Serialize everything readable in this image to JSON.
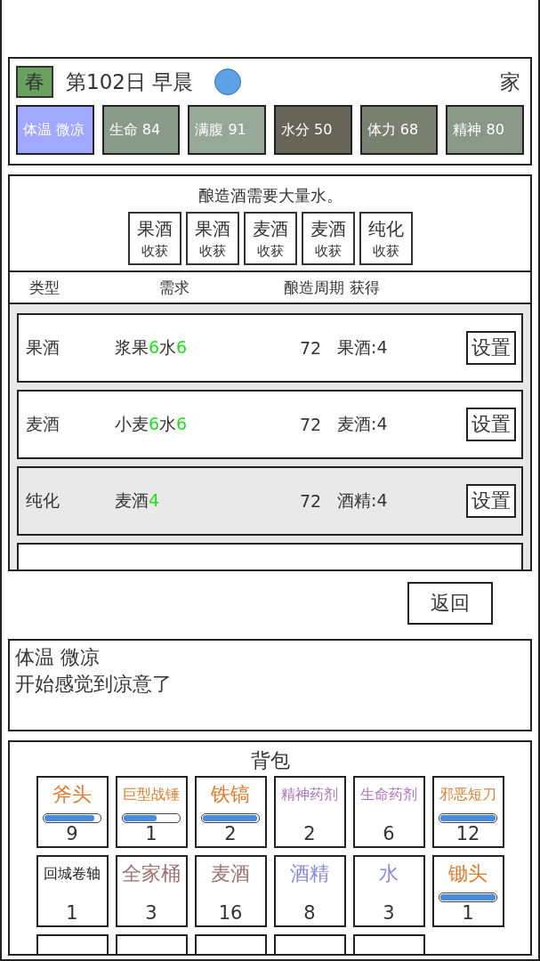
{
  "header": {
    "season": "春",
    "date": "第102日 早晨",
    "location": "家",
    "stats": [
      {
        "label": "体温 微凉",
        "color": "#a0a8ff"
      },
      {
        "label": "生命 84",
        "color": "#8a9a88"
      },
      {
        "label": "满腹 91",
        "color": "#98a898"
      },
      {
        "label": "水分 50",
        "color": "#666658"
      },
      {
        "label": "体力 68",
        "color": "#7a8070"
      },
      {
        "label": "精神 80",
        "color": "#8a9888"
      }
    ]
  },
  "brewing": {
    "notice": "酿造酒需要大量水。",
    "harvest_buttons": [
      {
        "name": "果酒",
        "action": "收获"
      },
      {
        "name": "果酒",
        "action": "收获"
      },
      {
        "name": "麦酒",
        "action": "收获"
      },
      {
        "name": "麦酒",
        "action": "收获"
      },
      {
        "name": "纯化",
        "action": "收获"
      }
    ],
    "columns": [
      "类型",
      "需求",
      "酿造周期",
      "获得"
    ],
    "recipes": [
      {
        "type": "果酒",
        "needs": [
          {
            "kind": "name",
            "text": "浆果"
          },
          {
            "kind": "amount",
            "text": "6"
          },
          {
            "kind": "name",
            "text": "水"
          },
          {
            "kind": "amount",
            "text": "6"
          }
        ],
        "cycle": "72",
        "yield": "果酒:4",
        "button": "设置",
        "selected": false
      },
      {
        "type": "麦酒",
        "needs": [
          {
            "kind": "name",
            "text": "小麦"
          },
          {
            "kind": "amount",
            "text": "6"
          },
          {
            "kind": "name",
            "text": "水"
          },
          {
            "kind": "amount",
            "text": "6"
          }
        ],
        "cycle": "72",
        "yield": "麦酒:4",
        "button": "设置",
        "selected": false
      },
      {
        "type": "纯化",
        "needs": [
          {
            "kind": "name",
            "text": "麦酒"
          },
          {
            "kind": "amount",
            "text": "4"
          }
        ],
        "cycle": "72",
        "yield": "酒精:4",
        "button": "设置",
        "selected": true
      }
    ]
  },
  "back_button": "返回",
  "message": {
    "title": "体温 微凉",
    "text": "开始感觉到凉意了"
  },
  "backpack": {
    "title": "背包",
    "items": [
      {
        "kind": "tool",
        "name": "斧头",
        "color": "#e07a2c",
        "level": 0.9,
        "count": "9"
      },
      {
        "kind": "tool",
        "name": "巨型战锤",
        "color": "#e07a2c",
        "level": 0.6,
        "count": "1"
      },
      {
        "kind": "tool",
        "name": "铁镐",
        "color": "#e07a2c",
        "level": 0.98,
        "count": "2"
      },
      {
        "kind": "plain",
        "name": "精神药剂",
        "color": "#b070c0",
        "count": "2"
      },
      {
        "kind": "plain",
        "name": "生命药剂",
        "color": "#b070c0",
        "count": "6"
      },
      {
        "kind": "tool",
        "name": "邪恶短刀",
        "color": "#e07a2c",
        "level": 1,
        "count": "12"
      },
      {
        "kind": "plain",
        "name": "回城卷轴",
        "color": "#222222",
        "count": "1"
      },
      {
        "kind": "plain",
        "name": "全家桶",
        "color": "#a07070",
        "count": "3"
      },
      {
        "kind": "plain",
        "name": "麦酒",
        "color": "#a07070",
        "count": "16"
      },
      {
        "kind": "plain",
        "name": "酒精",
        "color": "#8888dd",
        "count": "8"
      },
      {
        "kind": "plain",
        "name": "水",
        "color": "#8888dd",
        "count": "3"
      },
      {
        "kind": "tool",
        "name": "锄头",
        "color": "#e07a2c",
        "level": 1,
        "count": "1"
      },
      {
        "kind": "cut"
      },
      {
        "kind": "cut"
      },
      {
        "kind": "cut"
      },
      {
        "kind": "cut"
      },
      {
        "kind": "cut"
      }
    ]
  }
}
